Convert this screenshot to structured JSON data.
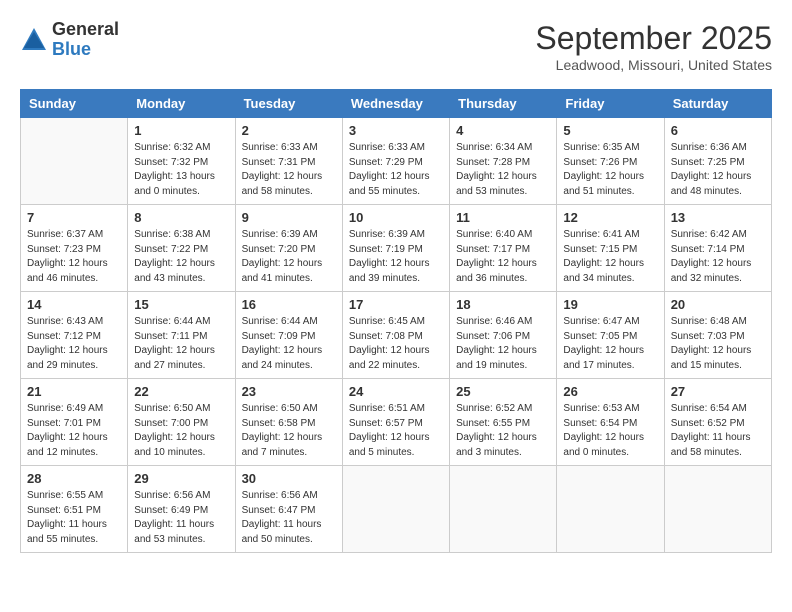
{
  "header": {
    "logo_general": "General",
    "logo_blue": "Blue",
    "month_title": "September 2025",
    "location": "Leadwood, Missouri, United States"
  },
  "days_of_week": [
    "Sunday",
    "Monday",
    "Tuesday",
    "Wednesday",
    "Thursday",
    "Friday",
    "Saturday"
  ],
  "weeks": [
    [
      {
        "day": "",
        "info": ""
      },
      {
        "day": "1",
        "info": "Sunrise: 6:32 AM\nSunset: 7:32 PM\nDaylight: 13 hours\nand 0 minutes."
      },
      {
        "day": "2",
        "info": "Sunrise: 6:33 AM\nSunset: 7:31 PM\nDaylight: 12 hours\nand 58 minutes."
      },
      {
        "day": "3",
        "info": "Sunrise: 6:33 AM\nSunset: 7:29 PM\nDaylight: 12 hours\nand 55 minutes."
      },
      {
        "day": "4",
        "info": "Sunrise: 6:34 AM\nSunset: 7:28 PM\nDaylight: 12 hours\nand 53 minutes."
      },
      {
        "day": "5",
        "info": "Sunrise: 6:35 AM\nSunset: 7:26 PM\nDaylight: 12 hours\nand 51 minutes."
      },
      {
        "day": "6",
        "info": "Sunrise: 6:36 AM\nSunset: 7:25 PM\nDaylight: 12 hours\nand 48 minutes."
      }
    ],
    [
      {
        "day": "7",
        "info": "Sunrise: 6:37 AM\nSunset: 7:23 PM\nDaylight: 12 hours\nand 46 minutes."
      },
      {
        "day": "8",
        "info": "Sunrise: 6:38 AM\nSunset: 7:22 PM\nDaylight: 12 hours\nand 43 minutes."
      },
      {
        "day": "9",
        "info": "Sunrise: 6:39 AM\nSunset: 7:20 PM\nDaylight: 12 hours\nand 41 minutes."
      },
      {
        "day": "10",
        "info": "Sunrise: 6:39 AM\nSunset: 7:19 PM\nDaylight: 12 hours\nand 39 minutes."
      },
      {
        "day": "11",
        "info": "Sunrise: 6:40 AM\nSunset: 7:17 PM\nDaylight: 12 hours\nand 36 minutes."
      },
      {
        "day": "12",
        "info": "Sunrise: 6:41 AM\nSunset: 7:15 PM\nDaylight: 12 hours\nand 34 minutes."
      },
      {
        "day": "13",
        "info": "Sunrise: 6:42 AM\nSunset: 7:14 PM\nDaylight: 12 hours\nand 32 minutes."
      }
    ],
    [
      {
        "day": "14",
        "info": "Sunrise: 6:43 AM\nSunset: 7:12 PM\nDaylight: 12 hours\nand 29 minutes."
      },
      {
        "day": "15",
        "info": "Sunrise: 6:44 AM\nSunset: 7:11 PM\nDaylight: 12 hours\nand 27 minutes."
      },
      {
        "day": "16",
        "info": "Sunrise: 6:44 AM\nSunset: 7:09 PM\nDaylight: 12 hours\nand 24 minutes."
      },
      {
        "day": "17",
        "info": "Sunrise: 6:45 AM\nSunset: 7:08 PM\nDaylight: 12 hours\nand 22 minutes."
      },
      {
        "day": "18",
        "info": "Sunrise: 6:46 AM\nSunset: 7:06 PM\nDaylight: 12 hours\nand 19 minutes."
      },
      {
        "day": "19",
        "info": "Sunrise: 6:47 AM\nSunset: 7:05 PM\nDaylight: 12 hours\nand 17 minutes."
      },
      {
        "day": "20",
        "info": "Sunrise: 6:48 AM\nSunset: 7:03 PM\nDaylight: 12 hours\nand 15 minutes."
      }
    ],
    [
      {
        "day": "21",
        "info": "Sunrise: 6:49 AM\nSunset: 7:01 PM\nDaylight: 12 hours\nand 12 minutes."
      },
      {
        "day": "22",
        "info": "Sunrise: 6:50 AM\nSunset: 7:00 PM\nDaylight: 12 hours\nand 10 minutes."
      },
      {
        "day": "23",
        "info": "Sunrise: 6:50 AM\nSunset: 6:58 PM\nDaylight: 12 hours\nand 7 minutes."
      },
      {
        "day": "24",
        "info": "Sunrise: 6:51 AM\nSunset: 6:57 PM\nDaylight: 12 hours\nand 5 minutes."
      },
      {
        "day": "25",
        "info": "Sunrise: 6:52 AM\nSunset: 6:55 PM\nDaylight: 12 hours\nand 3 minutes."
      },
      {
        "day": "26",
        "info": "Sunrise: 6:53 AM\nSunset: 6:54 PM\nDaylight: 12 hours\nand 0 minutes."
      },
      {
        "day": "27",
        "info": "Sunrise: 6:54 AM\nSunset: 6:52 PM\nDaylight: 11 hours\nand 58 minutes."
      }
    ],
    [
      {
        "day": "28",
        "info": "Sunrise: 6:55 AM\nSunset: 6:51 PM\nDaylight: 11 hours\nand 55 minutes."
      },
      {
        "day": "29",
        "info": "Sunrise: 6:56 AM\nSunset: 6:49 PM\nDaylight: 11 hours\nand 53 minutes."
      },
      {
        "day": "30",
        "info": "Sunrise: 6:56 AM\nSunset: 6:47 PM\nDaylight: 11 hours\nand 50 minutes."
      },
      {
        "day": "",
        "info": ""
      },
      {
        "day": "",
        "info": ""
      },
      {
        "day": "",
        "info": ""
      },
      {
        "day": "",
        "info": ""
      }
    ]
  ]
}
